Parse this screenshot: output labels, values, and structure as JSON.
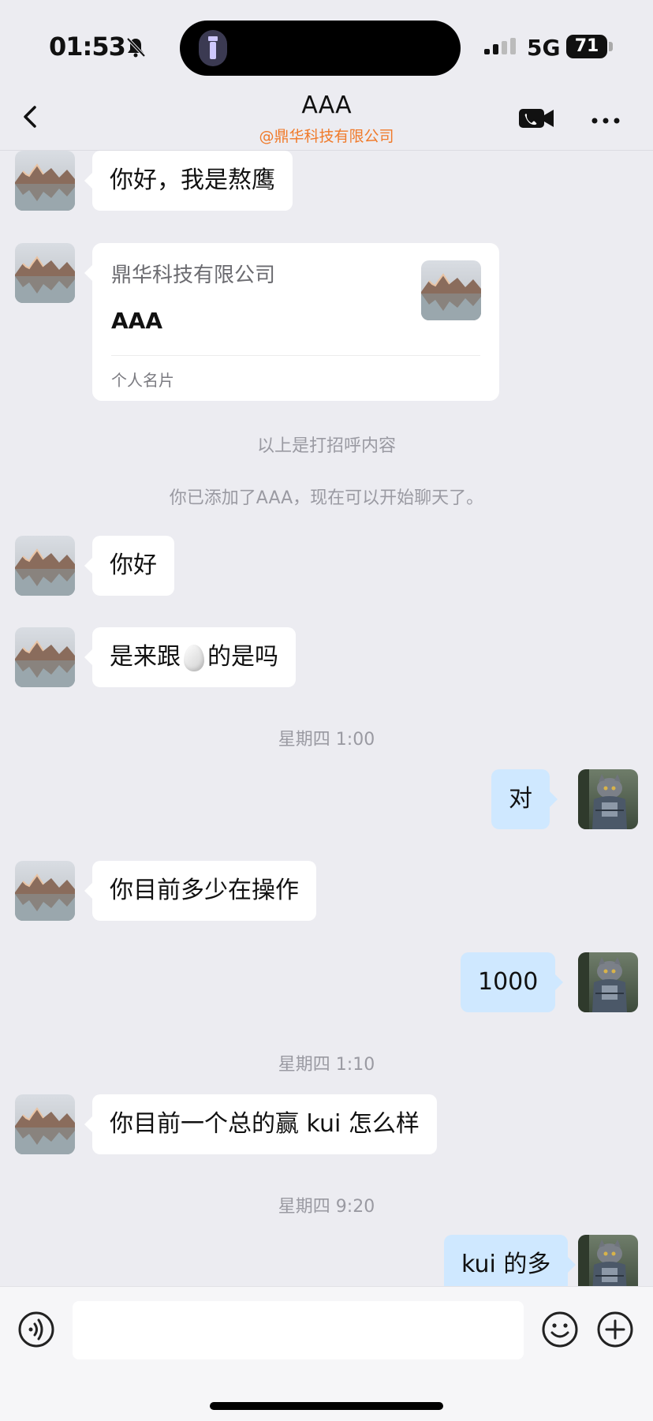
{
  "status": {
    "time": "01:53",
    "network": "5G",
    "battery": "71"
  },
  "header": {
    "title": "AAA",
    "subtitle": "@鼎华科技有限公司"
  },
  "messages": {
    "m1": "你好，我是熬鹰",
    "card": {
      "company": "鼎华科技有限公司",
      "name": "AAA",
      "type": "个人名片"
    },
    "sys1": "以上是打招呼内容",
    "sys2": "你已添加了AAA，现在可以开始聊天了。",
    "m2": "你好",
    "m3_before": "是来跟",
    "m3_after": "的是吗",
    "time1": "星期四 1:00",
    "m4": "对",
    "m5": "你目前多少在操作",
    "m6": "1000",
    "time2": "星期四 1:10",
    "m7": "你目前一个总的赢 kui 怎么样",
    "time3": "星期四 9:20",
    "m8": "kui 的多"
  },
  "colors": {
    "accent_subtitle": "#f07a2a",
    "outgoing_bubble": "#cfe8ff",
    "incoming_bubble": "#ffffff",
    "background": "#ececf1"
  },
  "icons": [
    "back-arrow-icon",
    "video-call-icon",
    "more-icon",
    "voice-icon",
    "emoji-icon",
    "plus-icon",
    "bell-slash-icon",
    "flashlight-icon",
    "egg-emoji-icon"
  ]
}
